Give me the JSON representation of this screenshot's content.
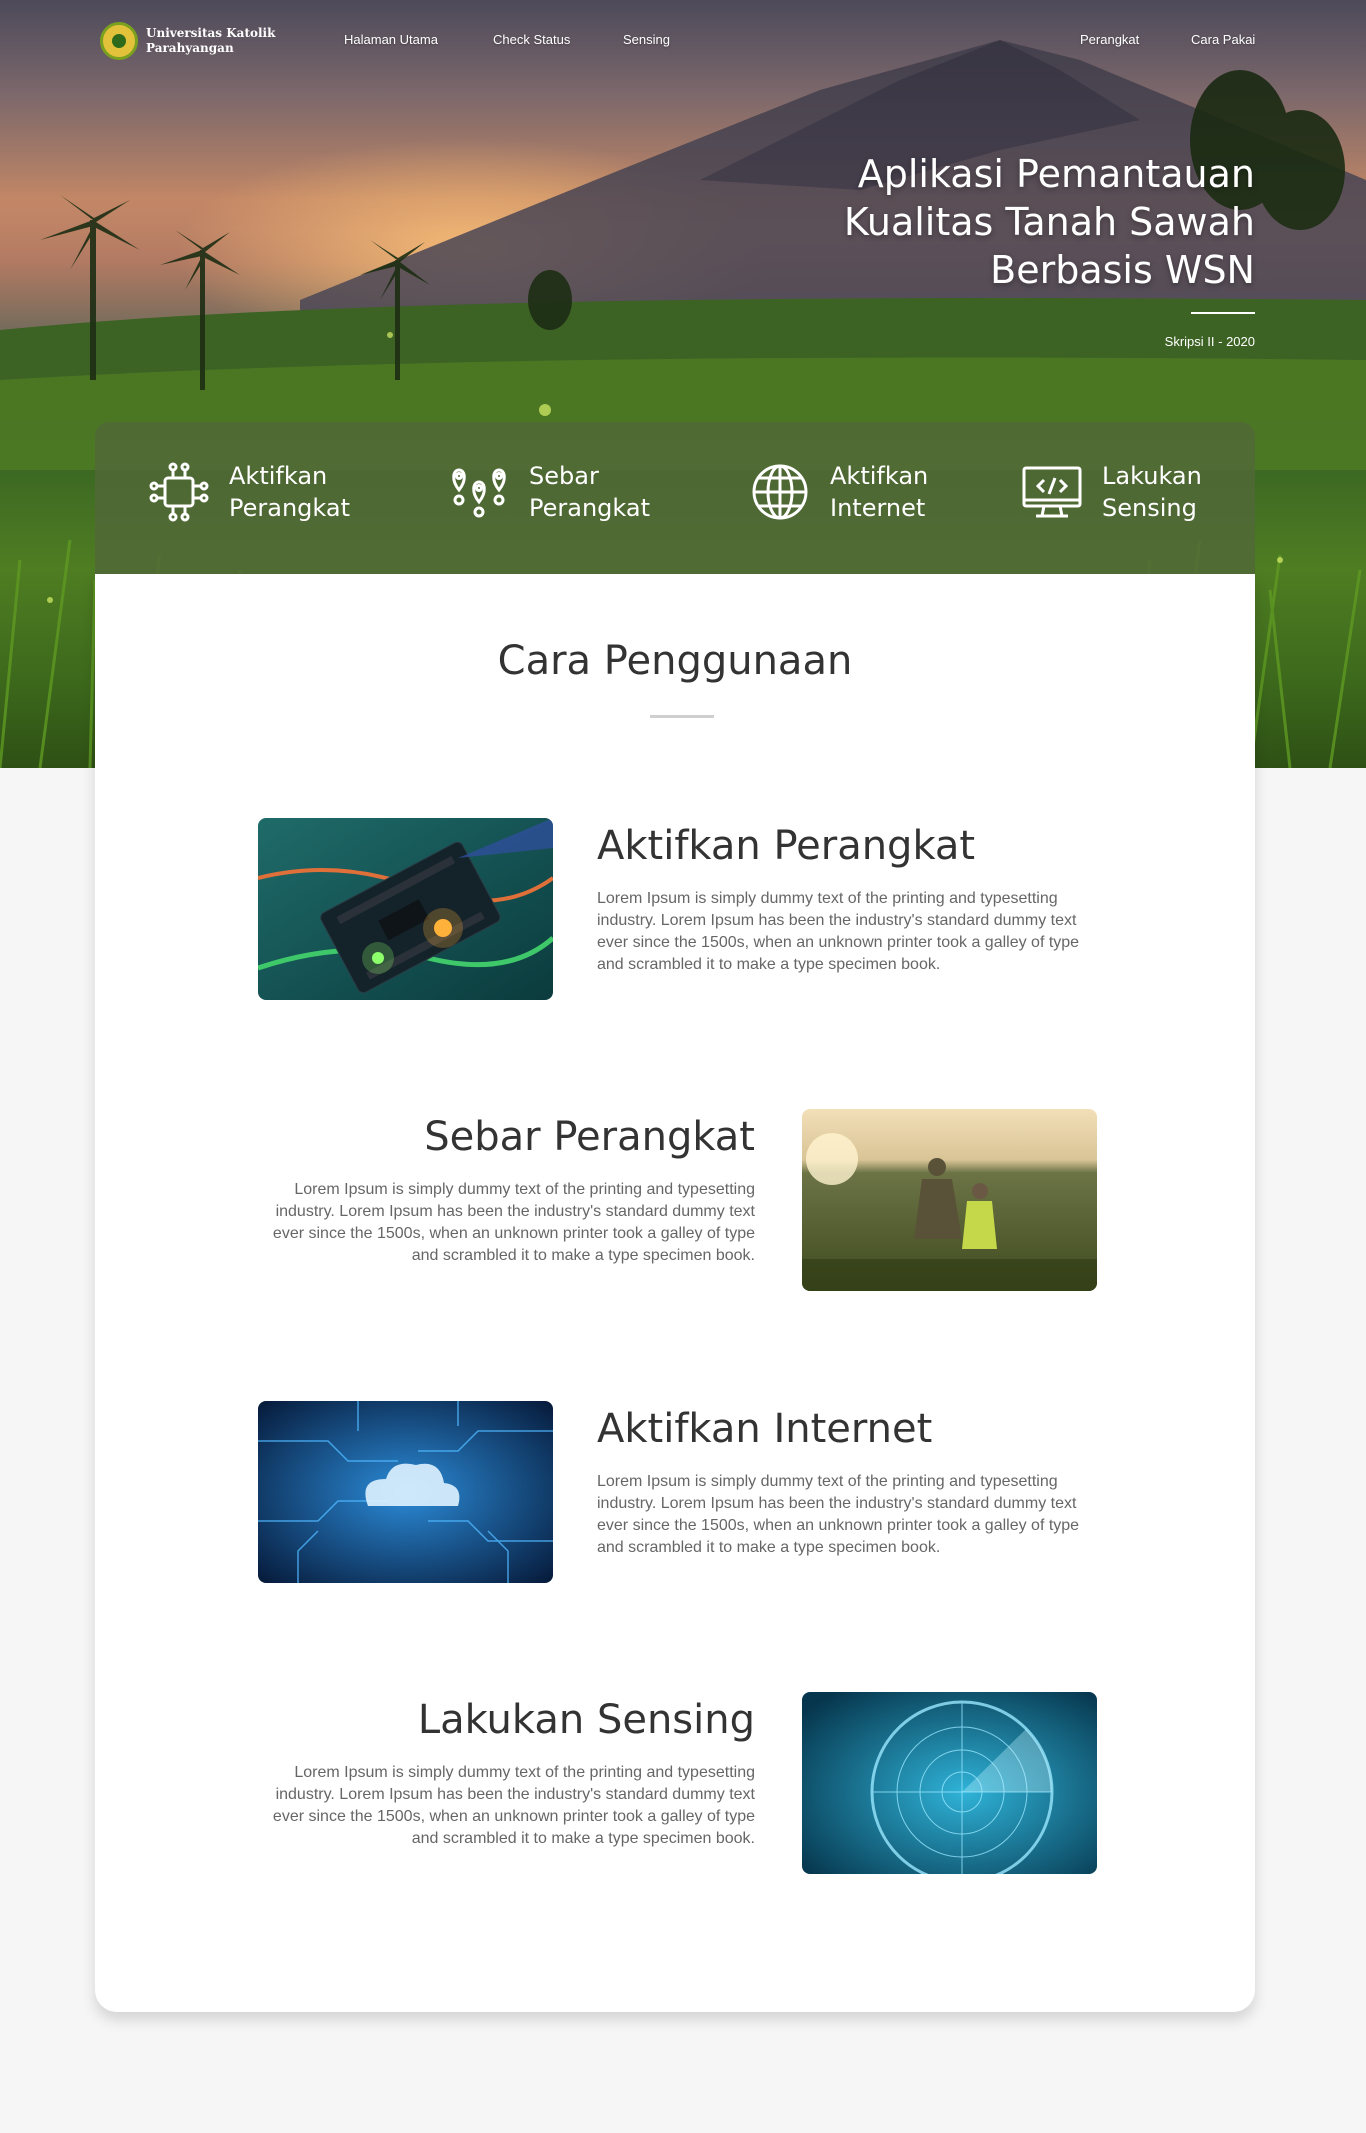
{
  "brand": {
    "name": "Universitas Katolik Parahyangan"
  },
  "nav": {
    "links": [
      "Halaman Utama",
      "Check Status",
      "Sensing"
    ],
    "right_links": [
      "Perangkat",
      "Cara Pakai"
    ]
  },
  "hero": {
    "title": "Aplikasi Pemantauan Kualitas Tanah Sawah Berbasis WSN",
    "subtitle": "Skripsi II - 2020"
  },
  "features": [
    {
      "label": "Aktifkan Perangkat",
      "icon": "chip-icon"
    },
    {
      "label": "Sebar Perangkat",
      "icon": "map-pins-icon"
    },
    {
      "label": "Aktifkan Internet",
      "icon": "globe-icon"
    },
    {
      "label": "Lakukan Sensing",
      "icon": "monitor-code-icon"
    }
  ],
  "section": {
    "title": "Cara Penggunaan"
  },
  "steps": [
    {
      "title": "Aktifkan Perangkat",
      "body": "Lorem Ipsum is simply dummy text of the printing and typesetting industry. Lorem Ipsum has been the industry's standard dummy text ever since the 1500s, when an unknown printer took a galley of type and scrambled it to make a type specimen book.",
      "image": "arduino-board-image"
    },
    {
      "title": "Sebar Perangkat",
      "body": "Lorem Ipsum is simply dummy text of the printing and typesetting industry. Lorem Ipsum has been the industry's standard dummy text ever since the 1500s, when an unknown printer took a galley of type and scrambled it to make a type specimen book.",
      "image": "farmers-field-image"
    },
    {
      "title": "Aktifkan Internet",
      "body": "Lorem Ipsum is simply dummy text of the printing and typesetting industry. Lorem Ipsum has been the industry's standard dummy text ever since the 1500s, when an unknown printer took a galley of type and scrambled it to make a type specimen book.",
      "image": "cloud-circuit-image"
    },
    {
      "title": "Lakukan Sensing",
      "body": "Lorem Ipsum is simply dummy text of the printing and typesetting industry. Lorem Ipsum has been the industry's standard dummy text ever since the 1500s, when an unknown printer took a galley of type and scrambled it to make a type specimen book.",
      "image": "radar-image"
    }
  ],
  "colors": {
    "feature_bar": "#52683a",
    "page_bg": "#f6f6f6",
    "card": "#ffffff"
  }
}
